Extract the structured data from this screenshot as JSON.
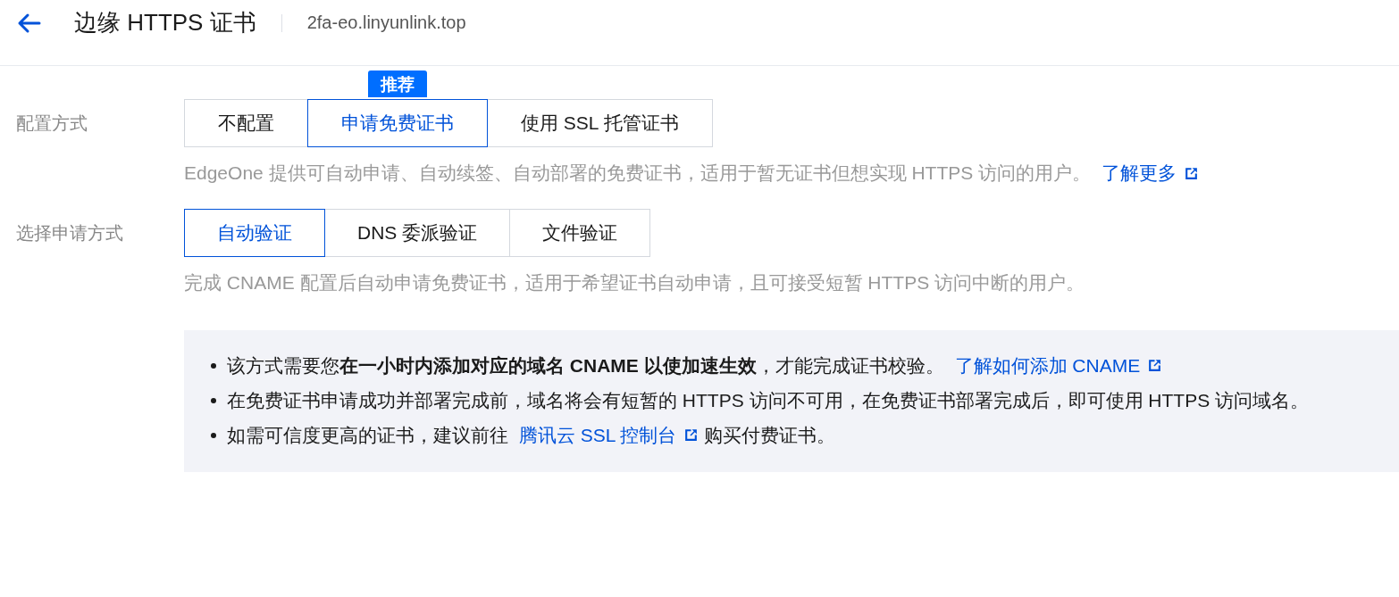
{
  "header": {
    "title": "边缘 HTTPS 证书",
    "domain": "2fa-eo.linyunlink.top"
  },
  "config_method": {
    "label": "配置方式",
    "badge": "推荐",
    "options": [
      {
        "label": "不配置",
        "selected": false,
        "badge": false
      },
      {
        "label": "申请免费证书",
        "selected": true,
        "badge": true
      },
      {
        "label": "使用 SSL 托管证书",
        "selected": false,
        "badge": false
      }
    ],
    "description": "EdgeOne 提供可自动申请、自动续签、自动部署的免费证书，适用于暂无证书但想实现 HTTPS 访问的用户。",
    "link": "了解更多"
  },
  "apply_method": {
    "label": "选择申请方式",
    "options": [
      {
        "label": "自动验证",
        "selected": true
      },
      {
        "label": "DNS 委派验证",
        "selected": false
      },
      {
        "label": "文件验证",
        "selected": false
      }
    ],
    "description": "完成 CNAME 配置后自动申请免费证书，适用于希望证书自动申请，且可接受短暂 HTTPS 访问中断的用户。"
  },
  "notice": [
    {
      "before": "该方式需要您**在一小时内添加对应的域名 CNAME 以使加速生效**，才能完成证书校验。 ",
      "link": "了解如何添加 CNAME"
    },
    {
      "before": "在免费证书申请成功并部署完成前，域名将会有短暂的 HTTPS 访问不可用，在免费证书部署完成后，即可使用 HTTPS 访问域名。"
    },
    {
      "before": "如需可信度更高的证书，建议前往 ",
      "link": "腾讯云 SSL 控制台",
      "after": " 购买付费证书。"
    }
  ]
}
